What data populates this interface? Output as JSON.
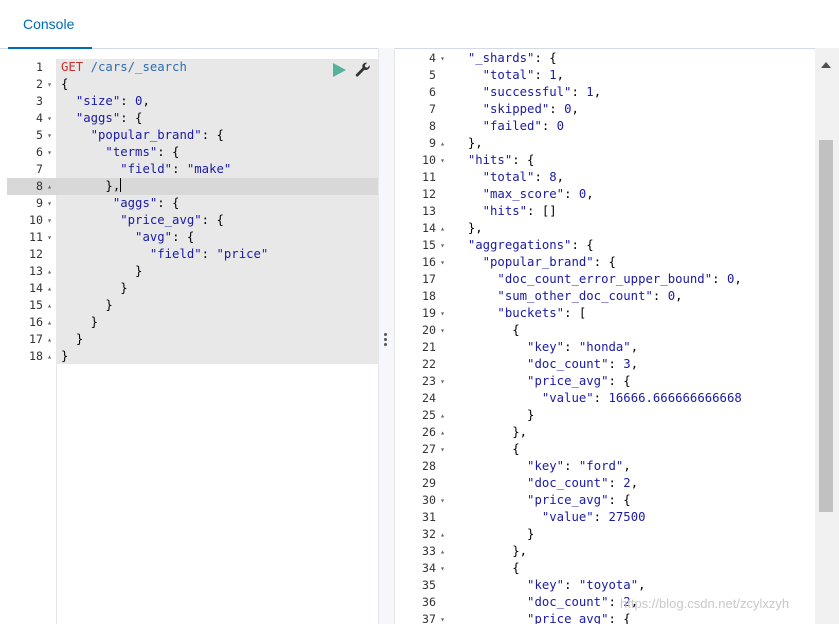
{
  "tab": {
    "label": "Console"
  },
  "request": {
    "lines": [
      {
        "n": "1",
        "fold": "",
        "html": "<span class=\"method\">GET</span> <span class=\"url\">/cars/_search</span>"
      },
      {
        "n": "2",
        "fold": "▾",
        "html": "<span class=\"plain\">{</span>"
      },
      {
        "n": "3",
        "fold": "",
        "html": "  <span class=\"str\">\"size\"</span><span class=\"plain\">: </span><span class=\"num\">0</span><span class=\"plain\">,</span>"
      },
      {
        "n": "4",
        "fold": "▾",
        "html": "  <span class=\"str\">\"aggs\"</span><span class=\"plain\">: {</span>"
      },
      {
        "n": "5",
        "fold": "▾",
        "html": "    <span class=\"str\">\"popular_brand\"</span><span class=\"plain\">: {</span>"
      },
      {
        "n": "6",
        "fold": "▾",
        "html": "      <span class=\"str\">\"terms\"</span><span class=\"plain\">: {</span>"
      },
      {
        "n": "7",
        "fold": "",
        "html": "        <span class=\"str\">\"field\"</span><span class=\"plain\">: </span><span class=\"str\">\"make\"</span>"
      },
      {
        "n": "8",
        "fold": "▴",
        "html": "      <span class=\"plain\">},</span><span class=\"cursor\"></span>",
        "active": true
      },
      {
        "n": "9",
        "fold": "▾",
        "html": "       <span class=\"str\">\"aggs\"</span><span class=\"plain\">: {</span>"
      },
      {
        "n": "10",
        "fold": "▾",
        "html": "        <span class=\"str\">\"price_avg\"</span><span class=\"plain\">: {</span>"
      },
      {
        "n": "11",
        "fold": "▾",
        "html": "          <span class=\"str\">\"avg\"</span><span class=\"plain\">: {</span>"
      },
      {
        "n": "12",
        "fold": "",
        "html": "            <span class=\"str\">\"field\"</span><span class=\"plain\">: </span><span class=\"str\">\"price\"</span>"
      },
      {
        "n": "13",
        "fold": "▴",
        "html": "          <span class=\"plain\">}</span>"
      },
      {
        "n": "14",
        "fold": "▴",
        "html": "        <span class=\"plain\">}</span>"
      },
      {
        "n": "15",
        "fold": "▴",
        "html": "      <span class=\"plain\">}</span>"
      },
      {
        "n": "16",
        "fold": "▴",
        "html": "    <span class=\"plain\">}</span>"
      },
      {
        "n": "17",
        "fold": "▴",
        "html": "  <span class=\"plain\">}</span>"
      },
      {
        "n": "18",
        "fold": "▴",
        "html": "<span class=\"plain\">}</span>"
      }
    ]
  },
  "response": {
    "lines": [
      {
        "n": "4",
        "fold": "▾",
        "html": "  <span class=\"str\">\"_shards\"</span><span class=\"plain\">: {</span>"
      },
      {
        "n": "5",
        "fold": "",
        "html": "    <span class=\"str\">\"total\"</span><span class=\"plain\">: </span><span class=\"num\">1</span><span class=\"plain\">,</span>"
      },
      {
        "n": "6",
        "fold": "",
        "html": "    <span class=\"str\">\"successful\"</span><span class=\"plain\">: </span><span class=\"num\">1</span><span class=\"plain\">,</span>"
      },
      {
        "n": "7",
        "fold": "",
        "html": "    <span class=\"str\">\"skipped\"</span><span class=\"plain\">: </span><span class=\"num\">0</span><span class=\"plain\">,</span>"
      },
      {
        "n": "8",
        "fold": "",
        "html": "    <span class=\"str\">\"failed\"</span><span class=\"plain\">: </span><span class=\"num\">0</span>"
      },
      {
        "n": "9",
        "fold": "▴",
        "html": "  <span class=\"plain\">},</span>"
      },
      {
        "n": "10",
        "fold": "▾",
        "html": "  <span class=\"str\">\"hits\"</span><span class=\"plain\">: {</span>"
      },
      {
        "n": "11",
        "fold": "",
        "html": "    <span class=\"str\">\"total\"</span><span class=\"plain\">: </span><span class=\"num\">8</span><span class=\"plain\">,</span>"
      },
      {
        "n": "12",
        "fold": "",
        "html": "    <span class=\"str\">\"max_score\"</span><span class=\"plain\">: </span><span class=\"num\">0</span><span class=\"plain\">,</span>"
      },
      {
        "n": "13",
        "fold": "",
        "html": "    <span class=\"str\">\"hits\"</span><span class=\"plain\">: []</span>"
      },
      {
        "n": "14",
        "fold": "▴",
        "html": "  <span class=\"plain\">},</span>"
      },
      {
        "n": "15",
        "fold": "▾",
        "html": "  <span class=\"str\">\"aggregations\"</span><span class=\"plain\">: {</span>"
      },
      {
        "n": "16",
        "fold": "▾",
        "html": "    <span class=\"str\">\"popular_brand\"</span><span class=\"plain\">: {</span>"
      },
      {
        "n": "17",
        "fold": "",
        "html": "      <span class=\"str\">\"doc_count_error_upper_bound\"</span><span class=\"plain\">: </span><span class=\"num\">0</span><span class=\"plain\">,</span>"
      },
      {
        "n": "18",
        "fold": "",
        "html": "      <span class=\"str\">\"sum_other_doc_count\"</span><span class=\"plain\">: </span><span class=\"num\">0</span><span class=\"plain\">,</span>"
      },
      {
        "n": "19",
        "fold": "▾",
        "html": "      <span class=\"str\">\"buckets\"</span><span class=\"plain\">: [</span>"
      },
      {
        "n": "20",
        "fold": "▾",
        "html": "        <span class=\"plain\">{</span>"
      },
      {
        "n": "21",
        "fold": "",
        "html": "          <span class=\"str\">\"key\"</span><span class=\"plain\">: </span><span class=\"str\">\"honda\"</span><span class=\"plain\">,</span>"
      },
      {
        "n": "22",
        "fold": "",
        "html": "          <span class=\"str\">\"doc_count\"</span><span class=\"plain\">: </span><span class=\"num\">3</span><span class=\"plain\">,</span>"
      },
      {
        "n": "23",
        "fold": "▾",
        "html": "          <span class=\"str\">\"price_avg\"</span><span class=\"plain\">: {</span>"
      },
      {
        "n": "24",
        "fold": "",
        "html": "            <span class=\"str\">\"value\"</span><span class=\"plain\">: </span><span class=\"num\">16666.666666666668</span>"
      },
      {
        "n": "25",
        "fold": "▴",
        "html": "          <span class=\"plain\">}</span>"
      },
      {
        "n": "26",
        "fold": "▴",
        "html": "        <span class=\"plain\">},</span>"
      },
      {
        "n": "27",
        "fold": "▾",
        "html": "        <span class=\"plain\">{</span>"
      },
      {
        "n": "28",
        "fold": "",
        "html": "          <span class=\"str\">\"key\"</span><span class=\"plain\">: </span><span class=\"str\">\"ford\"</span><span class=\"plain\">,</span>"
      },
      {
        "n": "29",
        "fold": "",
        "html": "          <span class=\"str\">\"doc_count\"</span><span class=\"plain\">: </span><span class=\"num\">2</span><span class=\"plain\">,</span>"
      },
      {
        "n": "30",
        "fold": "▾",
        "html": "          <span class=\"str\">\"price_avg\"</span><span class=\"plain\">: {</span>"
      },
      {
        "n": "31",
        "fold": "",
        "html": "            <span class=\"str\">\"value\"</span><span class=\"plain\">: </span><span class=\"num\">27500</span>"
      },
      {
        "n": "32",
        "fold": "▴",
        "html": "          <span class=\"plain\">}</span>"
      },
      {
        "n": "33",
        "fold": "▴",
        "html": "        <span class=\"plain\">},</span>"
      },
      {
        "n": "34",
        "fold": "▾",
        "html": "        <span class=\"plain\">{</span>"
      },
      {
        "n": "35",
        "fold": "",
        "html": "          <span class=\"str\">\"key\"</span><span class=\"plain\">: </span><span class=\"str\">\"toyota\"</span><span class=\"plain\">,</span>"
      },
      {
        "n": "36",
        "fold": "",
        "html": "          <span class=\"str\">\"doc_count\"</span><span class=\"plain\">: </span><span class=\"num\">2</span><span class=\"plain\">,</span>"
      },
      {
        "n": "37",
        "fold": "▾",
        "html": "          <span class=\"str\">\"price_avg\"</span><span class=\"plain\">: {</span>"
      }
    ]
  },
  "watermark": "https://blog.csdn.net/zcylxzyh",
  "icons": {
    "run": "play-icon",
    "settings": "wrench-icon"
  },
  "colors": {
    "accent": "#006bb4",
    "run": "#54b399",
    "method": "#c5302c",
    "string": "#1a1aa6"
  }
}
